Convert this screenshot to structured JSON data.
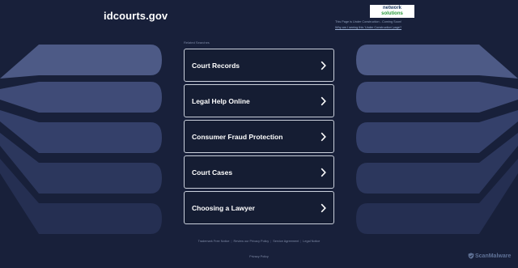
{
  "header": {
    "domain": "idcourts.gov",
    "logo_line1": "network",
    "logo_line2": "solutions",
    "notice_text": "This Page is Under Construction - Coming Soon!",
    "notice_link": "Why am I seeing this 'Under Construction' page?"
  },
  "related": {
    "label": "Related Searches",
    "items": [
      {
        "label": "Court Records"
      },
      {
        "label": "Legal Help Online"
      },
      {
        "label": "Consumer Fraud Protection"
      },
      {
        "label": "Court Cases"
      },
      {
        "label": "Choosing a Lawyer"
      }
    ]
  },
  "footer": {
    "links": [
      "Trademark Free Notice",
      "Review our Privacy Policy",
      "Service Agreement",
      "Legal Notice"
    ],
    "privacy": "Privacy Policy"
  },
  "badge": {
    "label": "ScanMalware",
    "icon": "shield-icon"
  },
  "colors": {
    "background": "#18203a",
    "button_border": "#c9cfdb",
    "bands": [
      "#4d5a86",
      "#3f4b77",
      "#34406a",
      "#2c375d",
      "#252f52"
    ]
  }
}
